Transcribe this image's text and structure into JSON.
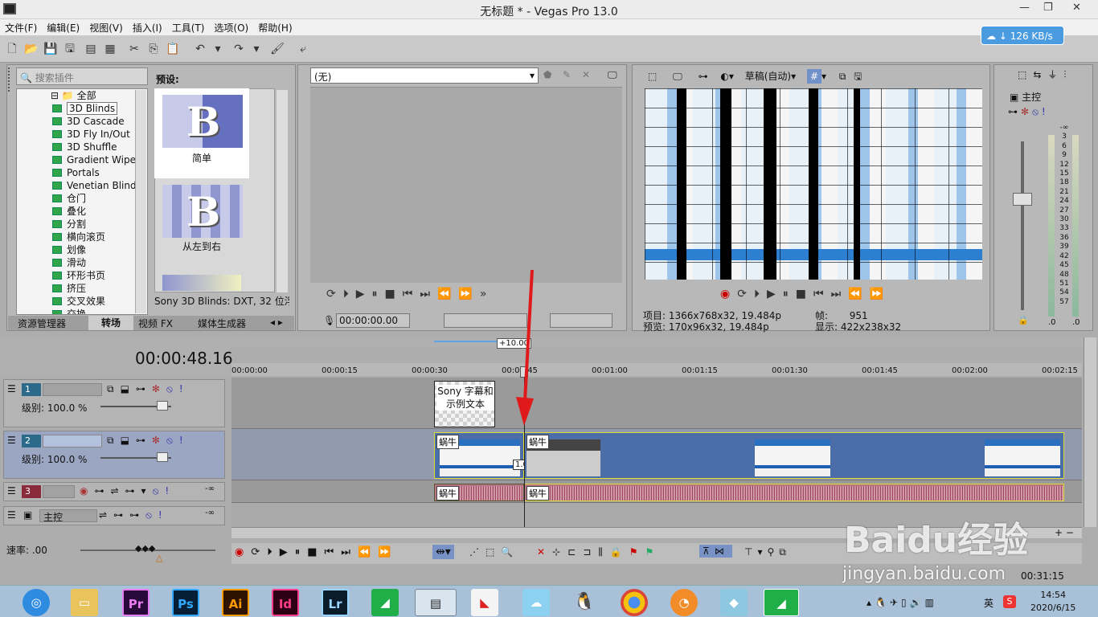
{
  "window": {
    "title": "无标题 * - Vegas Pro 13.0"
  },
  "menu": [
    "文件(F)",
    "编辑(E)",
    "视图(V)",
    "插入(I)",
    "工具(T)",
    "选项(O)",
    "帮助(H)"
  ],
  "network": {
    "speed": "126 KB/s"
  },
  "plugin_search": {
    "placeholder": "搜索插件"
  },
  "tree": {
    "root": "全部",
    "items": [
      "3D Blinds",
      "3D Cascade",
      "3D Fly In/Out",
      "3D Shuffle",
      "Gradient Wipe",
      "Portals",
      "Venetian Blinds",
      "仓门",
      "叠化",
      "分割",
      "横向滚页",
      "划像",
      "滑动",
      "环形书页",
      "挤压",
      "交叉效果",
      "交换"
    ]
  },
  "presets": {
    "label": "预设:",
    "items": [
      "简单",
      "从左到右"
    ],
    "status": "Sony 3D Blinds: DXT, 32 位浮"
  },
  "tabs": [
    "资源管理器",
    "转场",
    "视频 FX",
    "媒体生成器"
  ],
  "trimmer": {
    "dropdown": "(无)",
    "timecode": "00:00:00.00"
  },
  "preview": {
    "quality": "草稿(自动)",
    "project_label": "项目:",
    "project": "1366x768x32, 19.484p",
    "preview_label": "预览:",
    "preview": "170x96x32, 19.484p",
    "frame_label": "帧:",
    "frame": "951",
    "display_label": "显示:",
    "display": "422x238x32"
  },
  "mixer": {
    "label": "主控",
    "scale": [
      "-∞",
      "3",
      "6",
      "9",
      "12",
      "15",
      "18",
      "21",
      "24",
      "27",
      "30",
      "33",
      "36",
      "39",
      "42",
      "45",
      "48",
      "51",
      "54",
      "57"
    ],
    "bottom_left": ".0",
    "bottom_right": ".0"
  },
  "timeline": {
    "timecode": "00:00:48.16",
    "ruler": [
      "00:00:00",
      "00:00:15",
      "00:00:30",
      "00:00:45",
      "00:01:00",
      "00:01:15",
      "00:01:30",
      "00:01:45",
      "00:02:00",
      "00:02:15"
    ],
    "offset": "+10.00",
    "transition_time": "1.00"
  },
  "tracks": [
    {
      "num": "1",
      "level": "级别: 100.0 %"
    },
    {
      "num": "2",
      "level": "级别: 100.0 %"
    },
    {
      "num": "3",
      "vol": "-∞"
    },
    {
      "master": "主控",
      "vol": "-∞"
    }
  ],
  "clips": {
    "text_clip": "Sony 字幕和示例文本",
    "video_a": "蜗牛",
    "video_b": "蜗牛",
    "audio_a": "蜗牛",
    "audio_b": "蜗牛"
  },
  "rate": {
    "label": "速率: .00"
  },
  "status_time": "00:31:15",
  "taskbar": {
    "apps": [
      "Pr",
      "Ps",
      "Ai",
      "Id",
      "Lr"
    ],
    "ime": "英",
    "time": "14:54",
    "date": "2020/6/15"
  },
  "watermark": {
    "brand": "Baidu经验",
    "url": "jingyan.baidu.com"
  },
  "colors": {
    "arrow": "#e0191b",
    "accent": "#4a9be0",
    "selected_track": "#9ba6c2"
  }
}
